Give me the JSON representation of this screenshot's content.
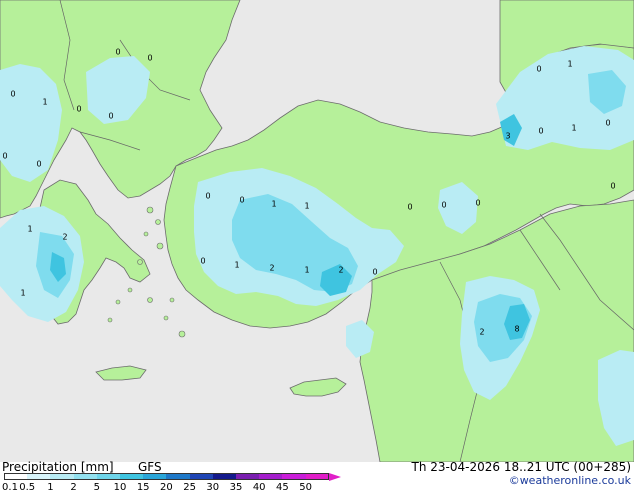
{
  "title": "Precipitation [mm]",
  "model": "GFS",
  "valid_time": "Th 23-04-2026 18..21 UTC (00+285)",
  "copyright": "©weatheronline.co.uk",
  "colors": {
    "sea": "#e9e9e9",
    "land": "#b6f09a",
    "precip_light": "#b9ecf4",
    "precip_mid": "#7fdcee",
    "precip_heavy": "#3fc4e0",
    "border": "#666666",
    "coast": "#6c6c6c"
  },
  "legend": {
    "ticks": [
      "0.1",
      "0.5",
      "1",
      "2",
      "5",
      "10",
      "15",
      "20",
      "25",
      "30",
      "35",
      "40",
      "45",
      "50"
    ],
    "colors": [
      "#ffffff",
      "#d8f4fa",
      "#b9ecf4",
      "#93e1ef",
      "#6fd5ea",
      "#3fc4e0",
      "#2aa6d9",
      "#1e78c8",
      "#1f45b5",
      "#141a8c",
      "#7a1fb0",
      "#a41ecc",
      "#c91ed8",
      "#e01ec8"
    ]
  },
  "values": [
    {
      "label": "0",
      "id": "v1"
    },
    {
      "label": "0",
      "id": "v2"
    },
    {
      "label": "0",
      "id": "v3"
    },
    {
      "label": "1",
      "id": "v4"
    },
    {
      "label": "0",
      "id": "v5"
    },
    {
      "label": "0",
      "id": "v6"
    },
    {
      "label": "0",
      "id": "v7"
    },
    {
      "label": "1",
      "id": "v8"
    },
    {
      "label": "2",
      "id": "v9"
    },
    {
      "label": "1",
      "id": "v10"
    },
    {
      "label": "0",
      "id": "v11"
    },
    {
      "label": "0",
      "id": "v12"
    },
    {
      "label": "1",
      "id": "v13"
    },
    {
      "label": "1",
      "id": "v14"
    },
    {
      "label": "0",
      "id": "v15"
    },
    {
      "label": "1",
      "id": "v16"
    },
    {
      "label": "2",
      "id": "v17"
    },
    {
      "label": "1",
      "id": "v18"
    },
    {
      "label": "2",
      "id": "v19"
    },
    {
      "label": "0",
      "id": "v20"
    },
    {
      "label": "0",
      "id": "v21"
    },
    {
      "label": "0",
      "id": "v22"
    },
    {
      "label": "0",
      "id": "v23"
    },
    {
      "label": "0",
      "id": "v24"
    },
    {
      "label": "1",
      "id": "v25"
    },
    {
      "label": "3",
      "id": "v26"
    },
    {
      "label": "0",
      "id": "v27"
    },
    {
      "label": "1",
      "id": "v28"
    },
    {
      "label": "0",
      "id": "v29"
    },
    {
      "label": "0",
      "id": "v30"
    },
    {
      "label": "0",
      "id": "v31"
    },
    {
      "label": "2",
      "id": "v32"
    },
    {
      "label": "8",
      "id": "v33"
    }
  ]
}
